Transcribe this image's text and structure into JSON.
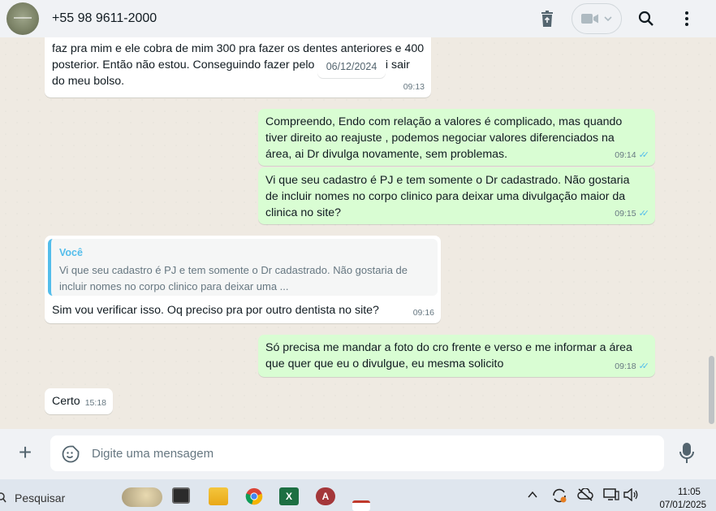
{
  "header": {
    "contact_name": "+55 98 9611-2000",
    "icons": [
      "avatar",
      "delete-icon",
      "video-icon",
      "chevron-down-icon",
      "search-icon",
      "menu-icon"
    ]
  },
  "chat": {
    "date_label": "06/12/2024",
    "messages": [
      {
        "dir": "in",
        "text": "faz pra mim e ele cobra de mim 300 pra fazer os dentes anteriores e 400 posterior. Então não estou. Conseguindo fazer pelo plano pois vai sair do meu bolso.",
        "time": "09:13"
      },
      {
        "dir": "out",
        "text": "Compreendo, Endo com relação a valores é complicado, mas quando tiver direito ao reajuste , podemos negociar valores diferenciados na área, ai Dr divulga novamente, sem problemas.",
        "time": "09:14"
      },
      {
        "dir": "out",
        "text": "Vi que seu cadastro é PJ e tem somente o Dr cadastrado. Não gostaria de incluir nomes no corpo clinico para deixar uma divulgação maior da clinica no site?",
        "time": "09:15"
      },
      {
        "dir": "in",
        "quote_author": "Você",
        "quote_text": "Vi que seu cadastro é PJ e tem somente o Dr cadastrado. Não gostaria de incluir nomes no corpo clinico para deixar uma ...",
        "text": "Sim vou verificar isso. Oq preciso pra por outro dentista no site?",
        "time": "09:16"
      },
      {
        "dir": "out",
        "text": "Só precisa me mandar a foto do cro frente e verso e me informar a área que quer que eu o divulgue, eu mesma solicito",
        "time": "09:18"
      },
      {
        "dir": "in",
        "text": "Certo",
        "time": "15:18"
      }
    ]
  },
  "composer": {
    "placeholder": "Digite uma mensagem"
  },
  "taskbar": {
    "search_label": "Pesquisar",
    "time": "11:05",
    "date": "07/01/2025"
  },
  "colors": {
    "outgoing_bubble": "#d9fdd3",
    "incoming_bubble": "#ffffff",
    "read_ticks": "#53bdeb",
    "chat_background": "#efeae2"
  }
}
